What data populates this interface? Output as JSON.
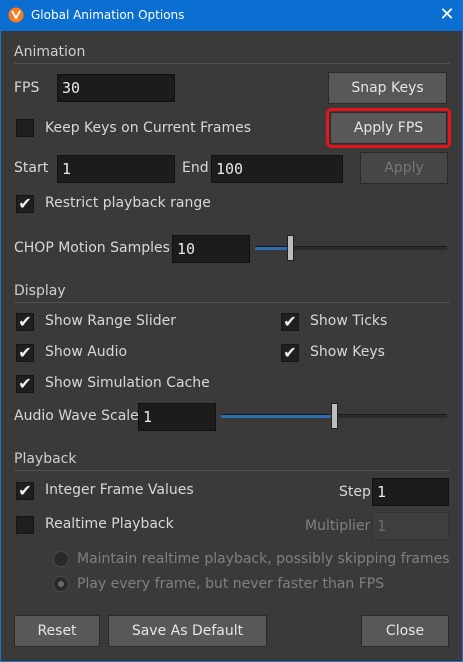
{
  "window": {
    "title": "Global Animation Options",
    "close_glyph": "✕",
    "icon": "houdini-app-icon"
  },
  "animation": {
    "section_label": "Animation",
    "fps_label": "FPS",
    "fps_value": "30",
    "snap_keys_label": "Snap Keys",
    "keep_keys_label": "Keep Keys on Current Frames",
    "keep_keys_checked": false,
    "apply_fps_label": "Apply FPS",
    "start_label": "Start",
    "start_value": "1",
    "end_label": "End",
    "end_value": "100",
    "apply_label": "Apply",
    "restrict_label": "Restrict playback range",
    "restrict_checked": true,
    "chop_label": "CHOP Motion Samples",
    "chop_value": "10",
    "chop_slider_fraction": 0.18
  },
  "display": {
    "section_label": "Display",
    "show_range_slider_label": "Show Range Slider",
    "show_ticks_label": "Show Ticks",
    "show_audio_label": "Show Audio",
    "show_keys_label": "Show Keys",
    "show_sim_cache_label": "Show Simulation Cache",
    "audio_wave_label": "Audio Wave Scale",
    "audio_wave_value": "1",
    "audio_slider_fraction": 0.5
  },
  "playback": {
    "section_label": "Playback",
    "integer_frames_label": "Integer Frame Values",
    "integer_frames_checked": true,
    "step_label": "Step",
    "step_value": "1",
    "realtime_label": "Realtime Playback",
    "realtime_checked": false,
    "multiplier_label": "Multiplier",
    "multiplier_value": "1",
    "radio_skip_label": "Maintain realtime playback, possibly skipping frames",
    "radio_every_label": "Play every frame, but never faster than FPS",
    "selected_radio": "every"
  },
  "footer": {
    "reset_label": "Reset",
    "save_default_label": "Save As Default",
    "close_label": "Close"
  },
  "colors": {
    "titlebar": "#0a6fd0",
    "highlight": "#e8141b",
    "slider_fill": "#2e6fb3"
  },
  "check_glyph": "✔"
}
